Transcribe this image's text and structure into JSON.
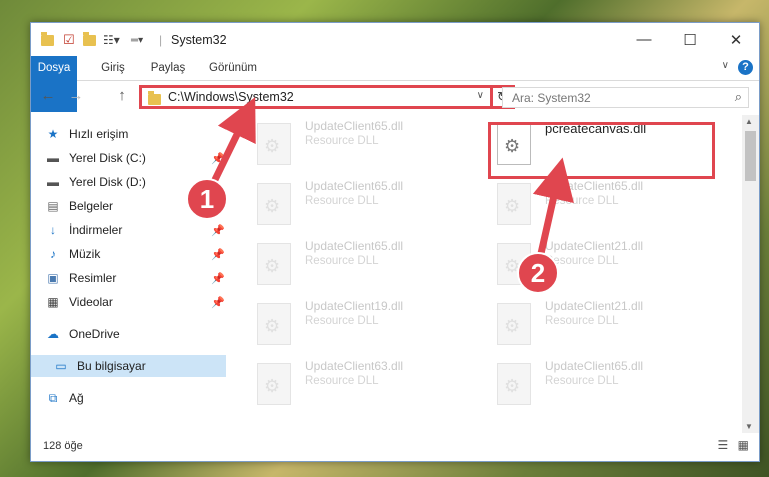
{
  "window": {
    "title": "System32",
    "controls": {
      "minimize": "—",
      "maximize": "☐",
      "close": "✕"
    }
  },
  "ribbon": {
    "tabs": [
      "Dosya",
      "Giriş",
      "Paylaş",
      "Görünüm"
    ],
    "help": "?"
  },
  "navigation": {
    "back": "←",
    "forward": "→",
    "up": "↑",
    "address": "C:\\Windows\\System32",
    "refresh": "↻",
    "search_placeholder": "Ara: System32"
  },
  "sidebar": {
    "items": [
      {
        "label": "Hızlı erişim",
        "icon": "star-icon"
      },
      {
        "label": "Yerel Disk (C:)",
        "icon": "drive-icon",
        "pinned": true
      },
      {
        "label": "Yerel Disk (D:)",
        "icon": "drive-icon",
        "pinned": false
      },
      {
        "label": "Belgeler",
        "icon": "document-icon",
        "pinned": true
      },
      {
        "label": "İndirmeler",
        "icon": "download-icon",
        "pinned": true
      },
      {
        "label": "Müzik",
        "icon": "music-icon",
        "pinned": true
      },
      {
        "label": "Resimler",
        "icon": "pictures-icon",
        "pinned": true
      },
      {
        "label": "Videolar",
        "icon": "video-icon",
        "pinned": true
      },
      {
        "label": "OneDrive",
        "icon": "cloud-icon"
      },
      {
        "label": "Bu bilgisayar",
        "icon": "computer-icon",
        "selected": true
      },
      {
        "label": "Ağ",
        "icon": "network-icon"
      }
    ]
  },
  "files": [
    {
      "name": "UpdateClient65.dll",
      "type": "Resource DLL"
    },
    {
      "name": "pcreatecanvas.dll",
      "type": ""
    },
    {
      "name": "UpdateClient65.dll",
      "type": "Resource DLL"
    },
    {
      "name": "UpdateClient65.dll",
      "type": "Resource DLL"
    },
    {
      "name": "UpdateClient65.dll",
      "type": "Resource DLL"
    },
    {
      "name": "UpdateClient21.dll",
      "type": "Resource DLL"
    },
    {
      "name": "UpdateClient19.dll",
      "type": "Resource DLL"
    },
    {
      "name": "UpdateClient21.dll",
      "type": "Resource DLL"
    },
    {
      "name": "UpdateClient63.dll",
      "type": "Resource DLL"
    },
    {
      "name": "UpdateClient65.dll",
      "type": "Resource DLL"
    }
  ],
  "status": {
    "count": "128 öğe"
  },
  "annotations": {
    "step1": "1",
    "step2": "2",
    "color": "#e0464f"
  }
}
